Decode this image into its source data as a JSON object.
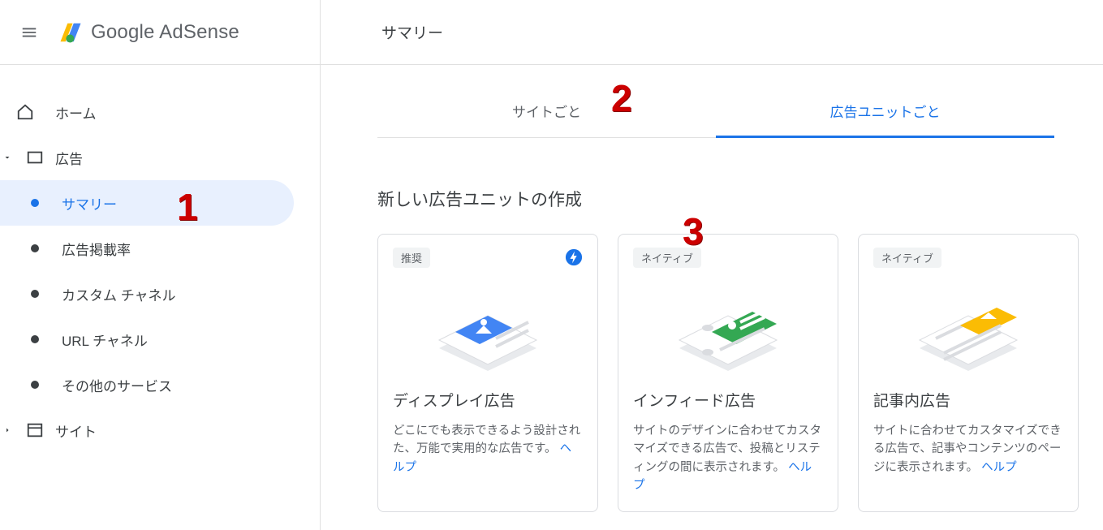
{
  "header": {
    "product_name_1": "Google",
    "product_name_2": " AdSense",
    "page_title": "サマリー"
  },
  "sidebar": {
    "home": "ホーム",
    "ads": "広告",
    "subs": [
      "サマリー",
      "広告掲載率",
      "カスタム チャネル",
      "URL チャネル",
      "その他のサービス"
    ],
    "sites": "サイト"
  },
  "tabs": {
    "by_site": "サイトごと",
    "by_unit": "広告ユニットごと"
  },
  "section_heading": "新しい広告ユニットの作成",
  "cards": [
    {
      "chip": "推奨",
      "title": "ディスプレイ広告",
      "desc": "どこにでも表示できるよう設計された、万能で実用的な広告です。",
      "help": "ヘルプ"
    },
    {
      "chip": "ネイティブ",
      "title": "インフィード広告",
      "desc": "サイトのデザインに合わせてカスタマイズできる広告で、投稿とリスティングの間に表示されます。",
      "help": "ヘルプ"
    },
    {
      "chip": "ネイティブ",
      "title": "記事内広告",
      "desc": "サイトに合わせてカスタマイズできる広告で、記事やコンテンツのページに表示されます。",
      "help": "ヘルプ"
    }
  ],
  "annotations": {
    "one": "1",
    "two": "2",
    "three": "3"
  }
}
